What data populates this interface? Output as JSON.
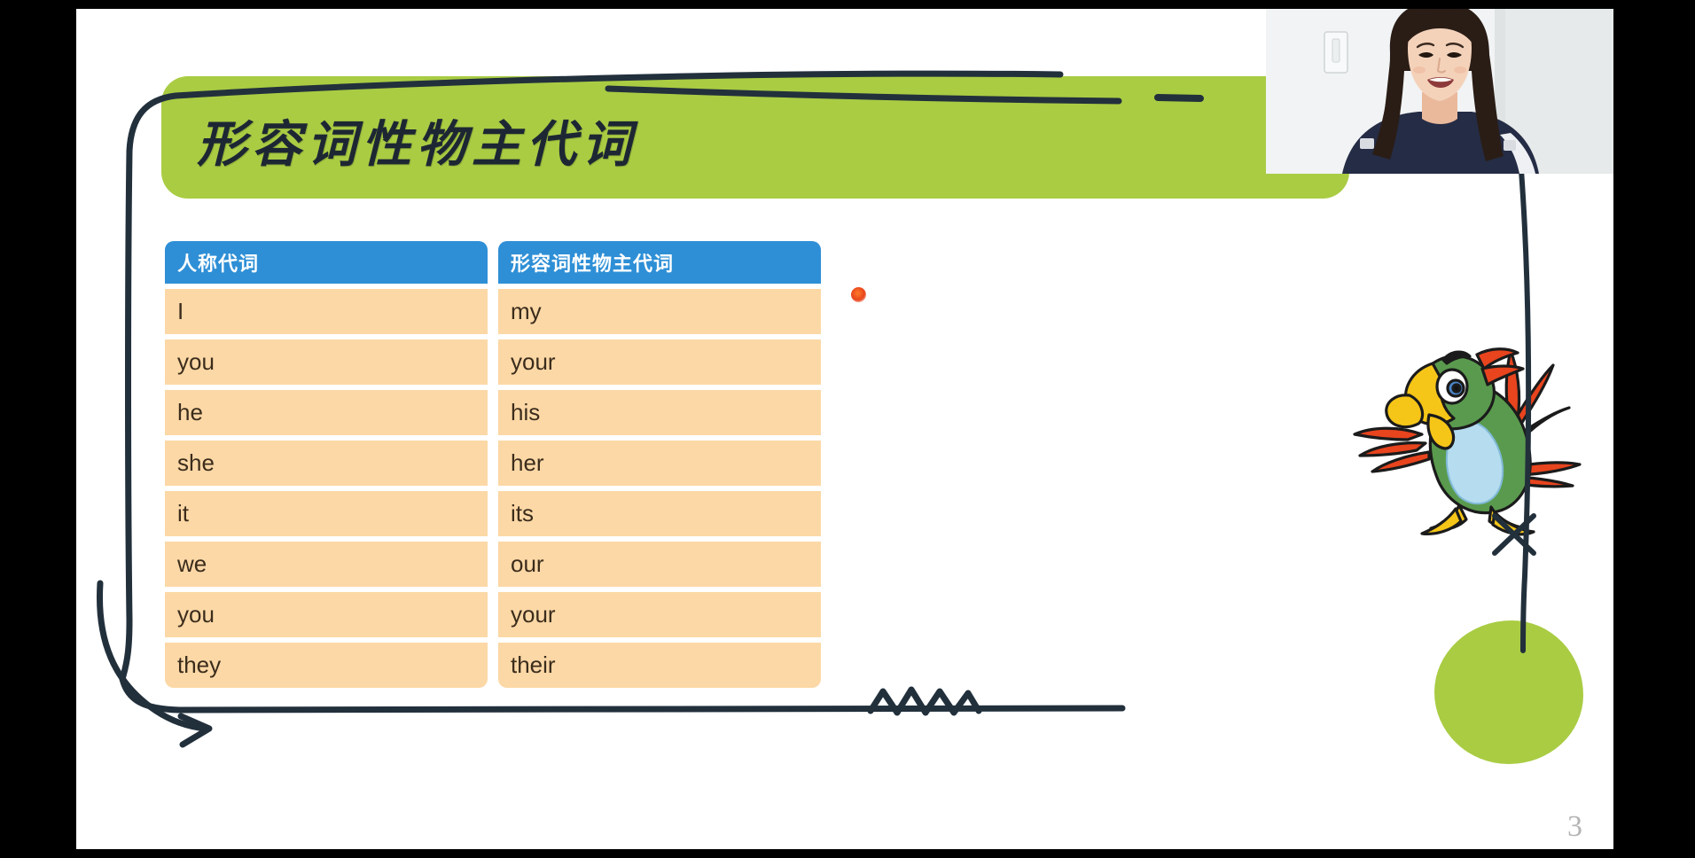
{
  "slide": {
    "title": "形容词性物主代词",
    "page_number": "3",
    "background_color": "#ffffff",
    "banner_color": "#a9cc43",
    "header_color": "#2e8fd6",
    "cell_color": "#fcd8a6",
    "ink_color": "#22303c",
    "pointer_color": "#e8451b"
  },
  "table": {
    "headers": [
      "人称代词",
      "形容词性物主代词"
    ],
    "rows": [
      [
        "I",
        "my"
      ],
      [
        "you",
        "your"
      ],
      [
        "he",
        "his"
      ],
      [
        "she",
        "her"
      ],
      [
        "it",
        "its"
      ],
      [
        "we",
        "our"
      ],
      [
        "you",
        "your"
      ],
      [
        "they",
        "their"
      ]
    ]
  },
  "annotations": {
    "frame_label": "hand-drawn-bracket-frame",
    "underline_label": "hand-drawn-underline",
    "squiggle_label": "hand-drawn-squiggle",
    "arrow_label": "hand-drawn-arrow",
    "dash_label": "hand-drawn-dash",
    "x_mark_label": "hand-drawn-x-mark"
  },
  "mascot": {
    "name": "parrot-mascot",
    "body_color": "#5a9a4e",
    "belly_color": "#b5dcef",
    "beak_color": "#f5c518",
    "wing_color": "#e8441e"
  },
  "webcam": {
    "label": "presenter-webcam",
    "wall_color": "#f2f4f5",
    "shirt_color": "#252c45",
    "hair_color": "#2a1d16",
    "skin_color": "#f2cdb3"
  }
}
